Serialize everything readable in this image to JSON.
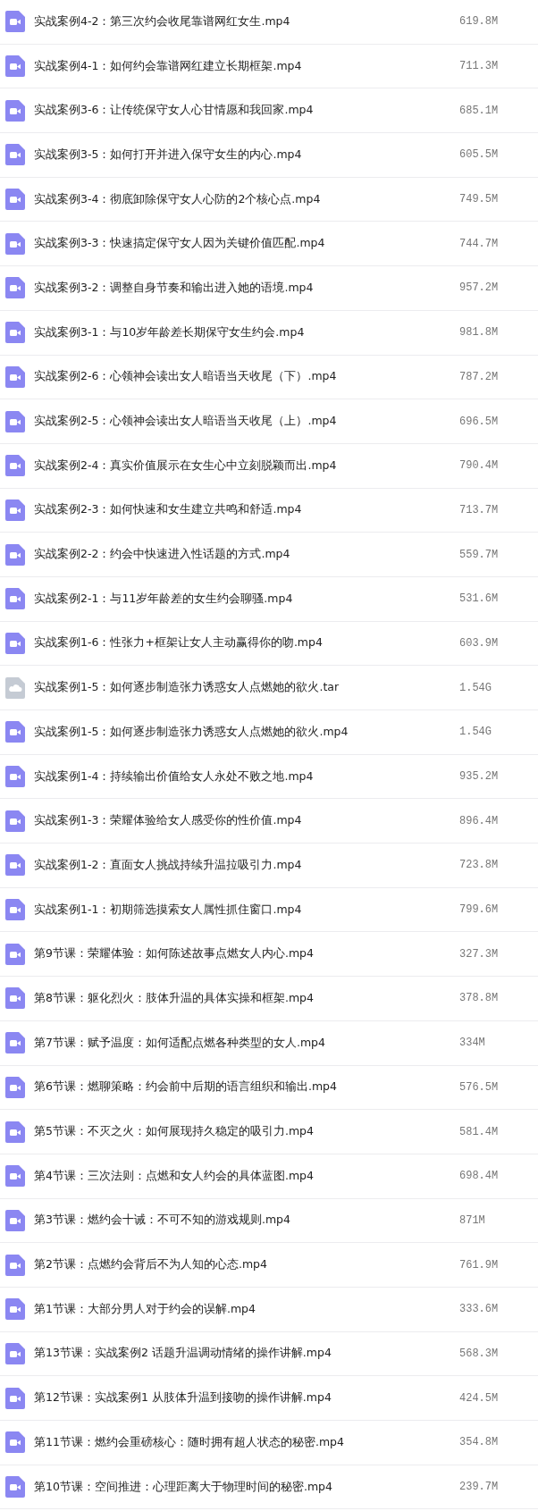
{
  "files": [
    {
      "kind": "video",
      "name": "实战案例4-2：第三次约会收尾靠谱网红女生.mp4",
      "size": "619.8M"
    },
    {
      "kind": "video",
      "name": "实战案例4-1：如何约会靠谱网红建立长期框架.mp4",
      "size": "711.3M"
    },
    {
      "kind": "video",
      "name": "实战案例3-6：让传统保守女人心甘情愿和我回家.mp4",
      "size": "685.1M"
    },
    {
      "kind": "video",
      "name": "实战案例3-5：如何打开并进入保守女生的内心.mp4",
      "size": "605.5M"
    },
    {
      "kind": "video",
      "name": "实战案例3-4：彻底卸除保守女人心防的2个核心点.mp4",
      "size": "749.5M"
    },
    {
      "kind": "video",
      "name": "实战案例3-3：快速搞定保守女人因为关键价值匹配.mp4",
      "size": "744.7M"
    },
    {
      "kind": "video",
      "name": "实战案例3-2：调整自身节奏和输出进入她的语境.mp4",
      "size": "957.2M"
    },
    {
      "kind": "video",
      "name": "实战案例3-1：与10岁年龄差长期保守女生约会.mp4",
      "size": "981.8M"
    },
    {
      "kind": "video",
      "name": "实战案例2-6：心领神会读出女人暗语当天收尾（下）.mp4",
      "size": "787.2M"
    },
    {
      "kind": "video",
      "name": "实战案例2-5：心领神会读出女人暗语当天收尾（上）.mp4",
      "size": "696.5M"
    },
    {
      "kind": "video",
      "name": "实战案例2-4：真实价值展示在女生心中立刻脱颖而出.mp4",
      "size": "790.4M"
    },
    {
      "kind": "video",
      "name": "实战案例2-3：如何快速和女生建立共鸣和舒适.mp4",
      "size": "713.7M"
    },
    {
      "kind": "video",
      "name": "实战案例2-2：约会中快速进入性话题的方式.mp4",
      "size": "559.7M"
    },
    {
      "kind": "video",
      "name": "实战案例2-1：与11岁年龄差的女生约会聊骚.mp4",
      "size": "531.6M"
    },
    {
      "kind": "video",
      "name": "实战案例1-6：性张力+框架让女人主动赢得你的吻.mp4",
      "size": "603.9M"
    },
    {
      "kind": "archive",
      "name": "实战案例1-5：如何逐步制造张力诱惑女人点燃她的欲火.tar",
      "size": "1.54G"
    },
    {
      "kind": "video",
      "name": "实战案例1-5：如何逐步制造张力诱惑女人点燃她的欲火.mp4",
      "size": "1.54G"
    },
    {
      "kind": "video",
      "name": "实战案例1-4：持续输出价值给女人永处不败之地.mp4",
      "size": "935.2M"
    },
    {
      "kind": "video",
      "name": "实战案例1-3：荣耀体验给女人感受你的性价值.mp4",
      "size": "896.4M"
    },
    {
      "kind": "video",
      "name": "实战案例1-2：直面女人挑战持续升温拉吸引力.mp4",
      "size": "723.8M"
    },
    {
      "kind": "video",
      "name": "实战案例1-1：初期筛选摸索女人属性抓住窗口.mp4",
      "size": "799.6M"
    },
    {
      "kind": "video",
      "name": "第9节课：荣耀体验：如何陈述故事点燃女人内心.mp4",
      "size": "327.3M"
    },
    {
      "kind": "video",
      "name": "第8节课：躯化烈火：肢体升温的具体实操和框架.mp4",
      "size": "378.8M"
    },
    {
      "kind": "video",
      "name": "第7节课：赋予温度：如何适配点燃各种类型的女人.mp4",
      "size": "334M"
    },
    {
      "kind": "video",
      "name": "第6节课：燃聊策略：约会前中后期的语言组织和输出.mp4",
      "size": "576.5M"
    },
    {
      "kind": "video",
      "name": "第5节课：不灭之火：如何展现持久稳定的吸引力.mp4",
      "size": "581.4M"
    },
    {
      "kind": "video",
      "name": "第4节课：三次法则：点燃和女人约会的具体蓝图.mp4",
      "size": "698.4M"
    },
    {
      "kind": "video",
      "name": "第3节课：燃约会十诫：不可不知的游戏规则.mp4",
      "size": "871M"
    },
    {
      "kind": "video",
      "name": "第2节课：点燃约会背后不为人知的心态.mp4",
      "size": "761.9M"
    },
    {
      "kind": "video",
      "name": "第1节课：大部分男人对于约会的误解.mp4",
      "size": "333.6M"
    },
    {
      "kind": "video",
      "name": "第13节课：实战案例2 话题升温调动情绪的操作讲解.mp4",
      "size": "568.3M"
    },
    {
      "kind": "video",
      "name": "第12节课：实战案例1 从肢体升温到接吻的操作讲解.mp4",
      "size": "424.5M"
    },
    {
      "kind": "video",
      "name": "第11节课：燃约会重磅核心：随时拥有超人状态的秘密.mp4",
      "size": "354.8M"
    },
    {
      "kind": "video",
      "name": "第10节课：空间推进：心理距离大于物理时间的秘密.mp4",
      "size": "239.7M"
    }
  ]
}
